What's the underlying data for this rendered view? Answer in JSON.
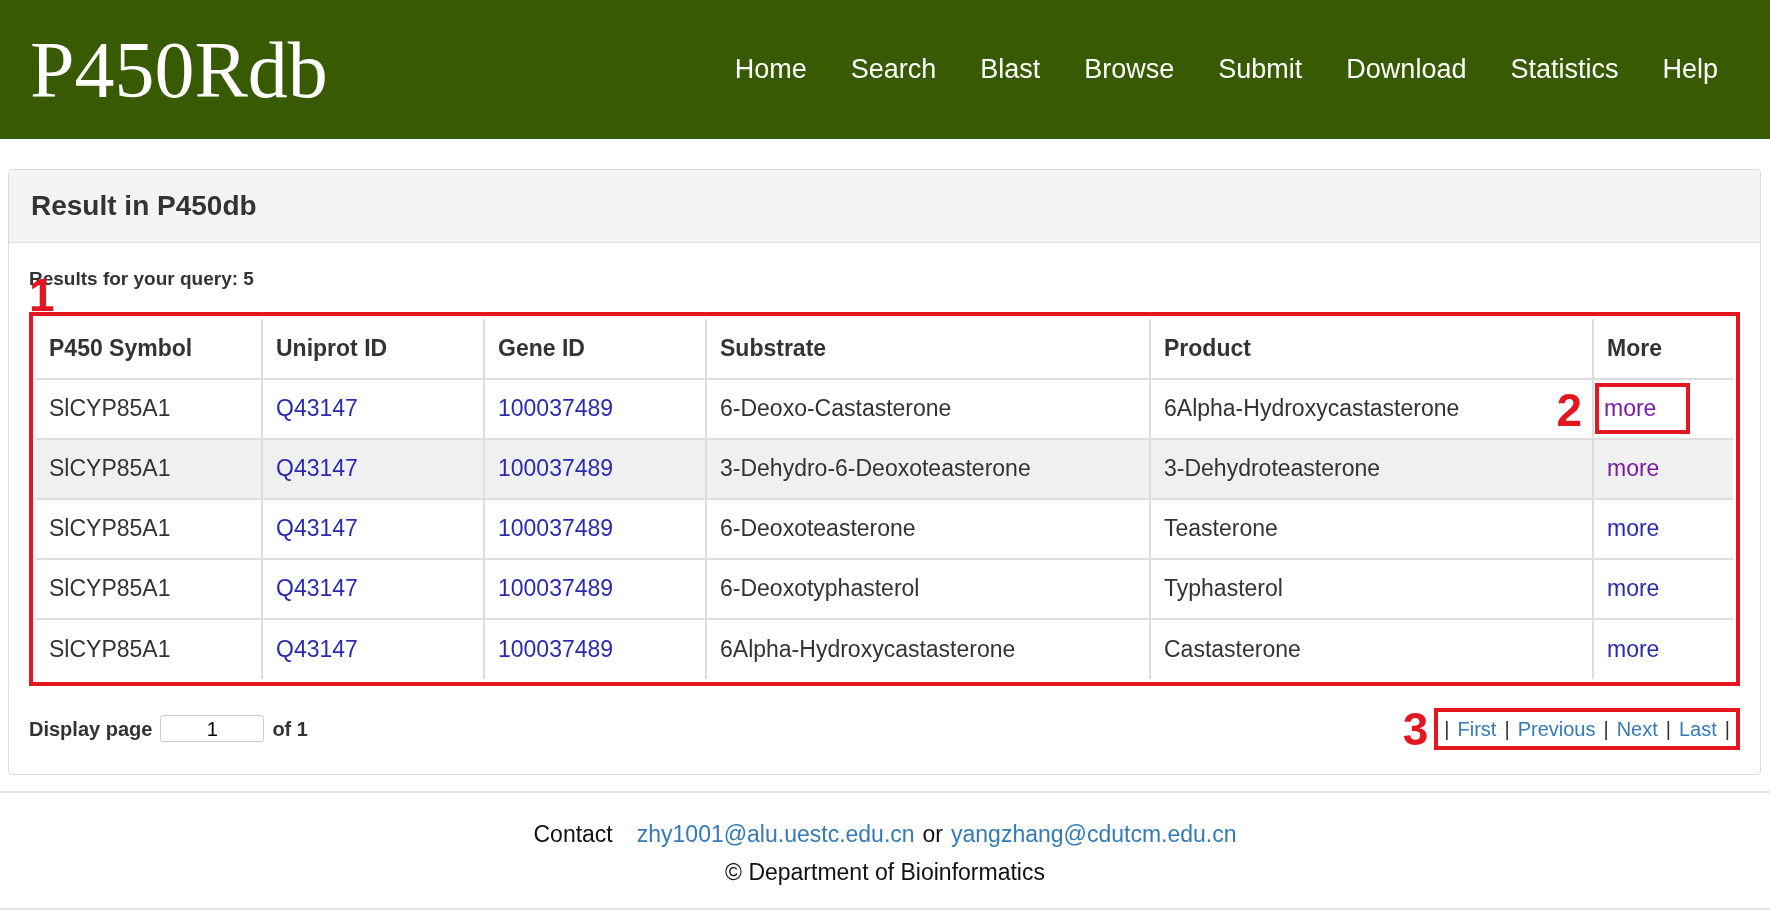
{
  "header": {
    "logo": "P450Rdb",
    "nav": [
      {
        "label": "Home"
      },
      {
        "label": "Search"
      },
      {
        "label": "Blast"
      },
      {
        "label": "Browse"
      },
      {
        "label": "Submit"
      },
      {
        "label": "Download"
      },
      {
        "label": "Statistics"
      },
      {
        "label": "Help"
      }
    ]
  },
  "panel": {
    "title": "Result in P450db",
    "summary": "Results for your query: 5"
  },
  "table": {
    "annotation": "1",
    "columns": [
      "P450 Symbol",
      "Uniprot ID",
      "Gene ID",
      "Substrate",
      "Product",
      "More"
    ],
    "rows": [
      {
        "symbol": "SlCYP85A1",
        "uniprot": "Q43147",
        "gene": "100037489",
        "substrate": "6-Deoxo-Castasterone",
        "product": "6Alpha-Hydroxycastasterone",
        "more": "more",
        "visited": true,
        "highlighted": false,
        "annotation": "2"
      },
      {
        "symbol": "SlCYP85A1",
        "uniprot": "Q43147",
        "gene": "100037489",
        "substrate": "3-Dehydro-6-Deoxoteasterone",
        "product": "3-Dehydroteasterone",
        "more": "more",
        "visited": true,
        "highlighted": true
      },
      {
        "symbol": "SlCYP85A1",
        "uniprot": "Q43147",
        "gene": "100037489",
        "substrate": "6-Deoxoteasterone",
        "product": "Teasterone",
        "more": "more",
        "visited": false,
        "highlighted": false
      },
      {
        "symbol": "SlCYP85A1",
        "uniprot": "Q43147",
        "gene": "100037489",
        "substrate": "6-Deoxotyphasterol",
        "product": "Typhasterol",
        "more": "more",
        "visited": false,
        "highlighted": false
      },
      {
        "symbol": "SlCYP85A1",
        "uniprot": "Q43147",
        "gene": "100037489",
        "substrate": "6Alpha-Hydroxycastasterone",
        "product": "Castasterone",
        "more": "more",
        "visited": false,
        "highlighted": false
      }
    ]
  },
  "pager": {
    "label": "Display page",
    "value": "1",
    "of": "of 1",
    "annotation": "3",
    "items": [
      {
        "kind": "sep",
        "text": "|"
      },
      {
        "kind": "link",
        "text": "First"
      },
      {
        "kind": "sep",
        "text": "|"
      },
      {
        "kind": "link",
        "text": "Previous"
      },
      {
        "kind": "sep",
        "text": "|"
      },
      {
        "kind": "link",
        "text": "Next"
      },
      {
        "kind": "sep",
        "text": "|"
      },
      {
        "kind": "link",
        "text": "Last"
      },
      {
        "kind": "sep",
        "text": "|"
      }
    ]
  },
  "footer": {
    "contact": "Contact",
    "email_1": "zhy1001@alu.uestc.edu.cn",
    "or": "or",
    "email_2": "yangzhang@cdutcm.edu.cn",
    "copyright": "© Department of Bioinformatics"
  }
}
